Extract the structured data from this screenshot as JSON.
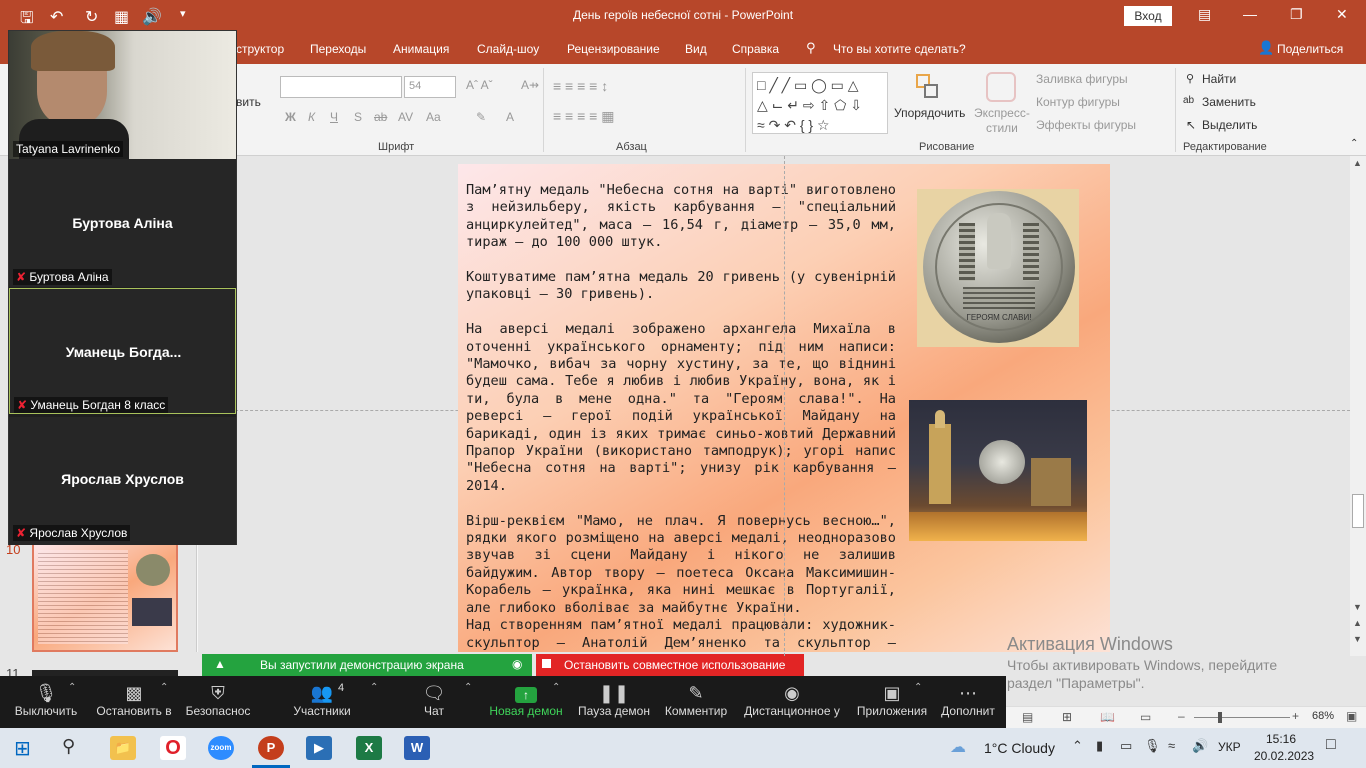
{
  "window": {
    "title": "День героїв небесної сотні  -  PowerPoint",
    "signin": "Вход"
  },
  "ribbon": {
    "tabs": [
      "структор",
      "Переходы",
      "Анимация",
      "Слайд-шоу",
      "Рецензирование",
      "Вид",
      "Справка",
      "Что вы хотите сделать?"
    ],
    "share": "Поделиться",
    "groups": {
      "font": "Шрифт",
      "paragraph": "Абзац",
      "drawing": "Рисование",
      "editing": "Редактирование"
    },
    "font_size": "54",
    "left_cut": "вить",
    "arrange": "Упорядочить",
    "quick_styles": "Экспресс-\nстили",
    "shape_fill": "Заливка фигуры",
    "shape_outline": "Контур фигуры",
    "shape_effects": "Эффекты фигуры",
    "find": "Найти",
    "replace": "Заменить",
    "select": "Выделить",
    "font_buttons": [
      "Ж",
      "К",
      "Ч",
      "S",
      "ab",
      "AV",
      "Aa",
      "A"
    ]
  },
  "slide": {
    "paragraphs": [
      "Пам’ятну медаль \"Небесна сотня на варті\" виготовлено з нейзильберу, якість карбування – \"спеціальний анциркулейтед\", маса – 16,54 г, діаметр – 35,0 мм, тираж – до 100 000 штук.",
      "Коштуватиме пам’ятна медаль 20 гривень (у сувенірній упаковці – 30 гривень).",
      "На аверсі медалі зображено архангела Михаїла в оточенні українського орнаменту; під ним написи: \"Мамочко, вибач за чорну хустину, за те, що віднині будеш сама. Тебе я любив і любив Україну, вона, як і ти, була в мене одна.\" та \"Героям слава!\". На реверсі – герої подій української Майдану на барикаді, один із яких тримає синьо-жовтий Державний Прапор України (використано тамподрук); угорі напис \"Небесна сотня на варті\"; унизу рік карбування – 2014.",
      "Вірш-реквієм \"Мамо, не плач. Я повернусь весною…\", рядки якого розміщено на аверсі медалі, неодноразово звучав зі сцени Майдану і нікого не залишив байдужим. Автор твору – поетеса Оксана Максимишин-Корабель – українка, яка нині мешкає в Португалії, але глибоко вболіває за майбутнє України.",
      "Над створенням пам’ятної медалі працювали: художник-скульптор – Анатолій Дем’яненко та скульптор – Володимир Атаманчук."
    ],
    "medal_text": "ГЕРОЯМ СЛАВИ!"
  },
  "thumbnails": {
    "slide_10": "10",
    "slide_11": "11"
  },
  "zoom": {
    "participants": [
      {
        "name": "Tatyana Lavrinenko",
        "label": ""
      },
      {
        "name": "Буртова Аліна",
        "label": "Буртова Аліна"
      },
      {
        "name": "Уманець  Богда...",
        "label": "Уманець Богдан 8 класс"
      },
      {
        "name": "Ярослав Хруслов",
        "label": "Ярослав Хруслов"
      }
    ],
    "share_banner": "Вы запустили демонстрацию экрана",
    "stop_share": "Остановить совместное использование",
    "toolbar": [
      {
        "label": "Выключить",
        "icon": "mic-icon"
      },
      {
        "label": "Остановить в",
        "icon": "camera-icon"
      },
      {
        "label": "Безопаснос",
        "icon": "shield-icon"
      },
      {
        "label": "Участники",
        "icon": "participants-icon",
        "count": "4"
      },
      {
        "label": "Чат",
        "icon": "chat-icon"
      },
      {
        "label": "Новая демон",
        "icon": "share-screen-icon"
      },
      {
        "label": "Пауза демон",
        "icon": "pause-icon"
      },
      {
        "label": "Комментир",
        "icon": "annotate-icon"
      },
      {
        "label": "Дистанционное у",
        "icon": "remote-control-icon"
      },
      {
        "label": "Приложения",
        "icon": "apps-icon"
      },
      {
        "label": "Дополнит",
        "icon": "more-icon"
      }
    ]
  },
  "statusbar": {
    "zoom": "68%"
  },
  "activation": {
    "title": "Активация Windows",
    "line1": "Чтобы активировать Windows, перейдите",
    "line2": "раздел \"Параметры\"."
  },
  "taskbar": {
    "weather": "1°C  Cloudy",
    "lang": "УКР",
    "time": "15:16",
    "date": "20.02.2023"
  },
  "colors": {
    "powerpoint_accent": "#b7472a",
    "share_green": "#24a33f",
    "stop_red": "#e22525"
  }
}
